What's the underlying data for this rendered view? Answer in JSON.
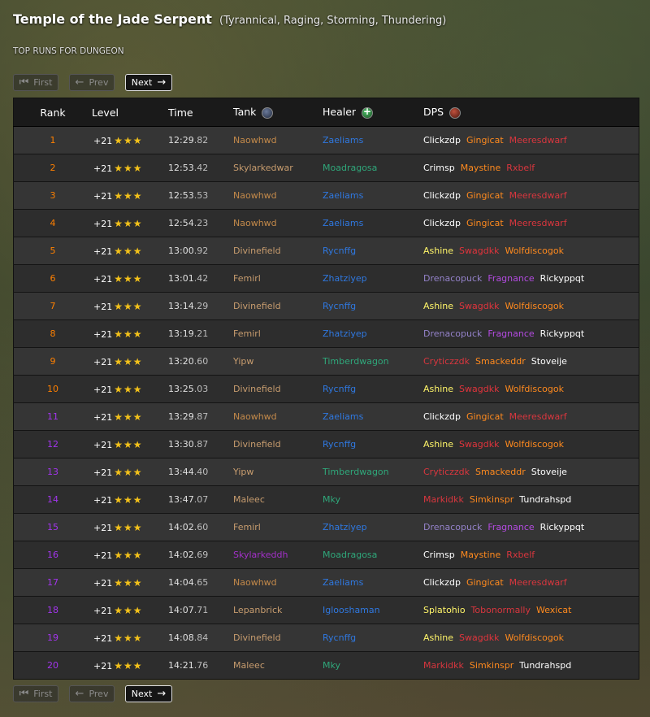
{
  "header": {
    "title": "Temple of the Jade Serpent",
    "affixes": "(Tyrannical, Raging, Storming, Thundering)",
    "subtitle": "TOP RUNS FOR DUNGEON"
  },
  "pagination": {
    "first": "First",
    "prev": "Prev",
    "next": "Next"
  },
  "table": {
    "headers": {
      "rank": "Rank",
      "level": "Level",
      "time": "Time",
      "tank": "Tank",
      "healer": "Healer",
      "dps": "DPS"
    },
    "icons": {
      "tank": "shield-icon",
      "healer": "plus-icon",
      "dps": "sword-icon"
    },
    "colors": {
      "rank_orange": "#ff8000",
      "rank_purple": "#a335ee",
      "star": "#f4c21a",
      "warrior": "#c79c6e",
      "paladin": "#f58cba",
      "hunter": "#abd473",
      "rogue": "#fff569",
      "priest": "#ffffff",
      "deathknight": "#c41f3b",
      "shaman": "#0070de",
      "mage": "#69ccf0",
      "warlock": "#9482c9",
      "monk": "#00ff96",
      "druid": "#ff7d0a",
      "demonhunter": "#a330c9",
      "evoker": "#33937f"
    },
    "rows": [
      {
        "rank": "1",
        "level": "+21",
        "time_main": "12:29",
        "time_ms": ".82",
        "tank": "Naowhwd",
        "tank_color": "#c48a4a",
        "healer": "Zaeliams",
        "healer_color": "#2f78e0",
        "dps": [
          {
            "name": "Clickzdp",
            "color": "#ffffff"
          },
          {
            "name": "Gingicat",
            "color": "#ff8a1e"
          },
          {
            "name": "Meeresdwarf",
            "color": "#d9363e"
          }
        ],
        "rank_color": "#ff8000"
      },
      {
        "rank": "2",
        "level": "+21",
        "time_main": "12:53",
        "time_ms": ".42",
        "tank": "Skylarkedwar",
        "tank_color": "#c79c6e",
        "healer": "Moadragosa",
        "healer_color": "#2fa77a",
        "dps": [
          {
            "name": "Crimsp",
            "color": "#ffffff"
          },
          {
            "name": "Maystine",
            "color": "#ff8a1e"
          },
          {
            "name": "Rxbelf",
            "color": "#d9363e"
          }
        ],
        "rank_color": "#ff8000"
      },
      {
        "rank": "3",
        "level": "+21",
        "time_main": "12:53",
        "time_ms": ".53",
        "tank": "Naowhwd",
        "tank_color": "#c48a4a",
        "healer": "Zaeliams",
        "healer_color": "#2f78e0",
        "dps": [
          {
            "name": "Clickzdp",
            "color": "#ffffff"
          },
          {
            "name": "Gingicat",
            "color": "#ff8a1e"
          },
          {
            "name": "Meeresdwarf",
            "color": "#d9363e"
          }
        ],
        "rank_color": "#ff8000"
      },
      {
        "rank": "4",
        "level": "+21",
        "time_main": "12:54",
        "time_ms": ".23",
        "tank": "Naowhwd",
        "tank_color": "#c48a4a",
        "healer": "Zaeliams",
        "healer_color": "#2f78e0",
        "dps": [
          {
            "name": "Clickzdp",
            "color": "#ffffff"
          },
          {
            "name": "Gingicat",
            "color": "#ff8a1e"
          },
          {
            "name": "Meeresdwarf",
            "color": "#d9363e"
          }
        ],
        "rank_color": "#ff8000"
      },
      {
        "rank": "5",
        "level": "+21",
        "time_main": "13:00",
        "time_ms": ".92",
        "tank": "Divinefield",
        "tank_color": "#c79c6e",
        "healer": "Rycnffg",
        "healer_color": "#2f78e0",
        "dps": [
          {
            "name": "Ashine",
            "color": "#fff569"
          },
          {
            "name": "Swagdkk",
            "color": "#e0343c"
          },
          {
            "name": "Wolfdiscogok",
            "color": "#ff8a1e"
          }
        ],
        "rank_color": "#ff8000"
      },
      {
        "rank": "6",
        "level": "+21",
        "time_main": "13:01",
        "time_ms": ".42",
        "tank": "Femirl",
        "tank_color": "#c79c6e",
        "healer": "Zhatziyep",
        "healer_color": "#2f78e0",
        "dps": [
          {
            "name": "Drenacopuck",
            "color": "#9482c9"
          },
          {
            "name": "Fragnance",
            "color": "#b34be0"
          },
          {
            "name": "Rickyppqt",
            "color": "#ffffff"
          }
        ],
        "rank_color": "#ff8000"
      },
      {
        "rank": "7",
        "level": "+21",
        "time_main": "13:14",
        "time_ms": ".29",
        "tank": "Divinefield",
        "tank_color": "#c79c6e",
        "healer": "Rycnffg",
        "healer_color": "#2f78e0",
        "dps": [
          {
            "name": "Ashine",
            "color": "#fff569"
          },
          {
            "name": "Swagdkk",
            "color": "#e0343c"
          },
          {
            "name": "Wolfdiscogok",
            "color": "#ff8a1e"
          }
        ],
        "rank_color": "#ff8000"
      },
      {
        "rank": "8",
        "level": "+21",
        "time_main": "13:19",
        "time_ms": ".21",
        "tank": "Femirl",
        "tank_color": "#c79c6e",
        "healer": "Zhatziyep",
        "healer_color": "#2f78e0",
        "dps": [
          {
            "name": "Drenacopuck",
            "color": "#9482c9"
          },
          {
            "name": "Fragnance",
            "color": "#b34be0"
          },
          {
            "name": "Rickyppqt",
            "color": "#ffffff"
          }
        ],
        "rank_color": "#ff8000"
      },
      {
        "rank": "9",
        "level": "+21",
        "time_main": "13:20",
        "time_ms": ".60",
        "tank": "Yipw",
        "tank_color": "#c79c6e",
        "healer": "Timberdwagon",
        "healer_color": "#2fa77a",
        "dps": [
          {
            "name": "Cryticzzdk",
            "color": "#d9363e"
          },
          {
            "name": "Smackeddr",
            "color": "#ff8a1e"
          },
          {
            "name": "Stoveije",
            "color": "#ffffff"
          }
        ],
        "rank_color": "#ff8000"
      },
      {
        "rank": "10",
        "level": "+21",
        "time_main": "13:25",
        "time_ms": ".03",
        "tank": "Divinefield",
        "tank_color": "#c79c6e",
        "healer": "Rycnffg",
        "healer_color": "#2f78e0",
        "dps": [
          {
            "name": "Ashine",
            "color": "#fff569"
          },
          {
            "name": "Swagdkk",
            "color": "#e0343c"
          },
          {
            "name": "Wolfdiscogok",
            "color": "#ff8a1e"
          }
        ],
        "rank_color": "#ff8000"
      },
      {
        "rank": "11",
        "level": "+21",
        "time_main": "13:29",
        "time_ms": ".87",
        "tank": "Naowhwd",
        "tank_color": "#c48a4a",
        "healer": "Zaeliams",
        "healer_color": "#2f78e0",
        "dps": [
          {
            "name": "Clickzdp",
            "color": "#ffffff"
          },
          {
            "name": "Gingicat",
            "color": "#ff8a1e"
          },
          {
            "name": "Meeresdwarf",
            "color": "#d9363e"
          }
        ],
        "rank_color": "#a335ee"
      },
      {
        "rank": "12",
        "level": "+21",
        "time_main": "13:30",
        "time_ms": ".87",
        "tank": "Divinefield",
        "tank_color": "#c79c6e",
        "healer": "Rycnffg",
        "healer_color": "#2f78e0",
        "dps": [
          {
            "name": "Ashine",
            "color": "#fff569"
          },
          {
            "name": "Swagdkk",
            "color": "#e0343c"
          },
          {
            "name": "Wolfdiscogok",
            "color": "#ff8a1e"
          }
        ],
        "rank_color": "#a335ee"
      },
      {
        "rank": "13",
        "level": "+21",
        "time_main": "13:44",
        "time_ms": ".40",
        "tank": "Yipw",
        "tank_color": "#c79c6e",
        "healer": "Timberdwagon",
        "healer_color": "#2fa77a",
        "dps": [
          {
            "name": "Cryticzzdk",
            "color": "#d9363e"
          },
          {
            "name": "Smackeddr",
            "color": "#ff8a1e"
          },
          {
            "name": "Stoveije",
            "color": "#ffffff"
          }
        ],
        "rank_color": "#a335ee"
      },
      {
        "rank": "14",
        "level": "+21",
        "time_main": "13:47",
        "time_ms": ".07",
        "tank": "Maleec",
        "tank_color": "#c79c6e",
        "healer": "Mky",
        "healer_color": "#2fa77a",
        "dps": [
          {
            "name": "Markidkk",
            "color": "#d9363e"
          },
          {
            "name": "Simkinspr",
            "color": "#ff8a1e"
          },
          {
            "name": "Tundrahspd",
            "color": "#ffffff"
          }
        ],
        "rank_color": "#a335ee"
      },
      {
        "rank": "15",
        "level": "+21",
        "time_main": "14:02",
        "time_ms": ".60",
        "tank": "Femirl",
        "tank_color": "#c79c6e",
        "healer": "Zhatziyep",
        "healer_color": "#2f78e0",
        "dps": [
          {
            "name": "Drenacopuck",
            "color": "#9482c9"
          },
          {
            "name": "Fragnance",
            "color": "#b34be0"
          },
          {
            "name": "Rickyppqt",
            "color": "#ffffff"
          }
        ],
        "rank_color": "#a335ee"
      },
      {
        "rank": "16",
        "level": "+21",
        "time_main": "14:02",
        "time_ms": ".69",
        "tank": "Skylarkeddh",
        "tank_color": "#a330c9",
        "healer": "Moadragosa",
        "healer_color": "#2fa77a",
        "dps": [
          {
            "name": "Crimsp",
            "color": "#ffffff"
          },
          {
            "name": "Maystine",
            "color": "#ff8a1e"
          },
          {
            "name": "Rxbelf",
            "color": "#d9363e"
          }
        ],
        "rank_color": "#a335ee"
      },
      {
        "rank": "17",
        "level": "+21",
        "time_main": "14:04",
        "time_ms": ".65",
        "tank": "Naowhwd",
        "tank_color": "#c48a4a",
        "healer": "Zaeliams",
        "healer_color": "#2f78e0",
        "dps": [
          {
            "name": "Clickzdp",
            "color": "#ffffff"
          },
          {
            "name": "Gingicat",
            "color": "#ff8a1e"
          },
          {
            "name": "Meeresdwarf",
            "color": "#d9363e"
          }
        ],
        "rank_color": "#a335ee"
      },
      {
        "rank": "18",
        "level": "+21",
        "time_main": "14:07",
        "time_ms": ".71",
        "tank": "Lepanbrick",
        "tank_color": "#c79c6e",
        "healer": "Iglooshaman",
        "healer_color": "#2f78e0",
        "dps": [
          {
            "name": "Splatohio",
            "color": "#fff569"
          },
          {
            "name": "Tobonormally",
            "color": "#d9363e"
          },
          {
            "name": "Wexicat",
            "color": "#ff8a1e"
          }
        ],
        "rank_color": "#a335ee"
      },
      {
        "rank": "19",
        "level": "+21",
        "time_main": "14:08",
        "time_ms": ".84",
        "tank": "Divinefield",
        "tank_color": "#c79c6e",
        "healer": "Rycnffg",
        "healer_color": "#2f78e0",
        "dps": [
          {
            "name": "Ashine",
            "color": "#fff569"
          },
          {
            "name": "Swagdkk",
            "color": "#e0343c"
          },
          {
            "name": "Wolfdiscogok",
            "color": "#ff8a1e"
          }
        ],
        "rank_color": "#a335ee"
      },
      {
        "rank": "20",
        "level": "+21",
        "time_main": "14:21",
        "time_ms": ".76",
        "tank": "Maleec",
        "tank_color": "#c79c6e",
        "healer": "Mky",
        "healer_color": "#2fa77a",
        "dps": [
          {
            "name": "Markidkk",
            "color": "#d9363e"
          },
          {
            "name": "Simkinspr",
            "color": "#ff8a1e"
          },
          {
            "name": "Tundrahspd",
            "color": "#ffffff"
          }
        ],
        "rank_color": "#a335ee"
      }
    ]
  }
}
